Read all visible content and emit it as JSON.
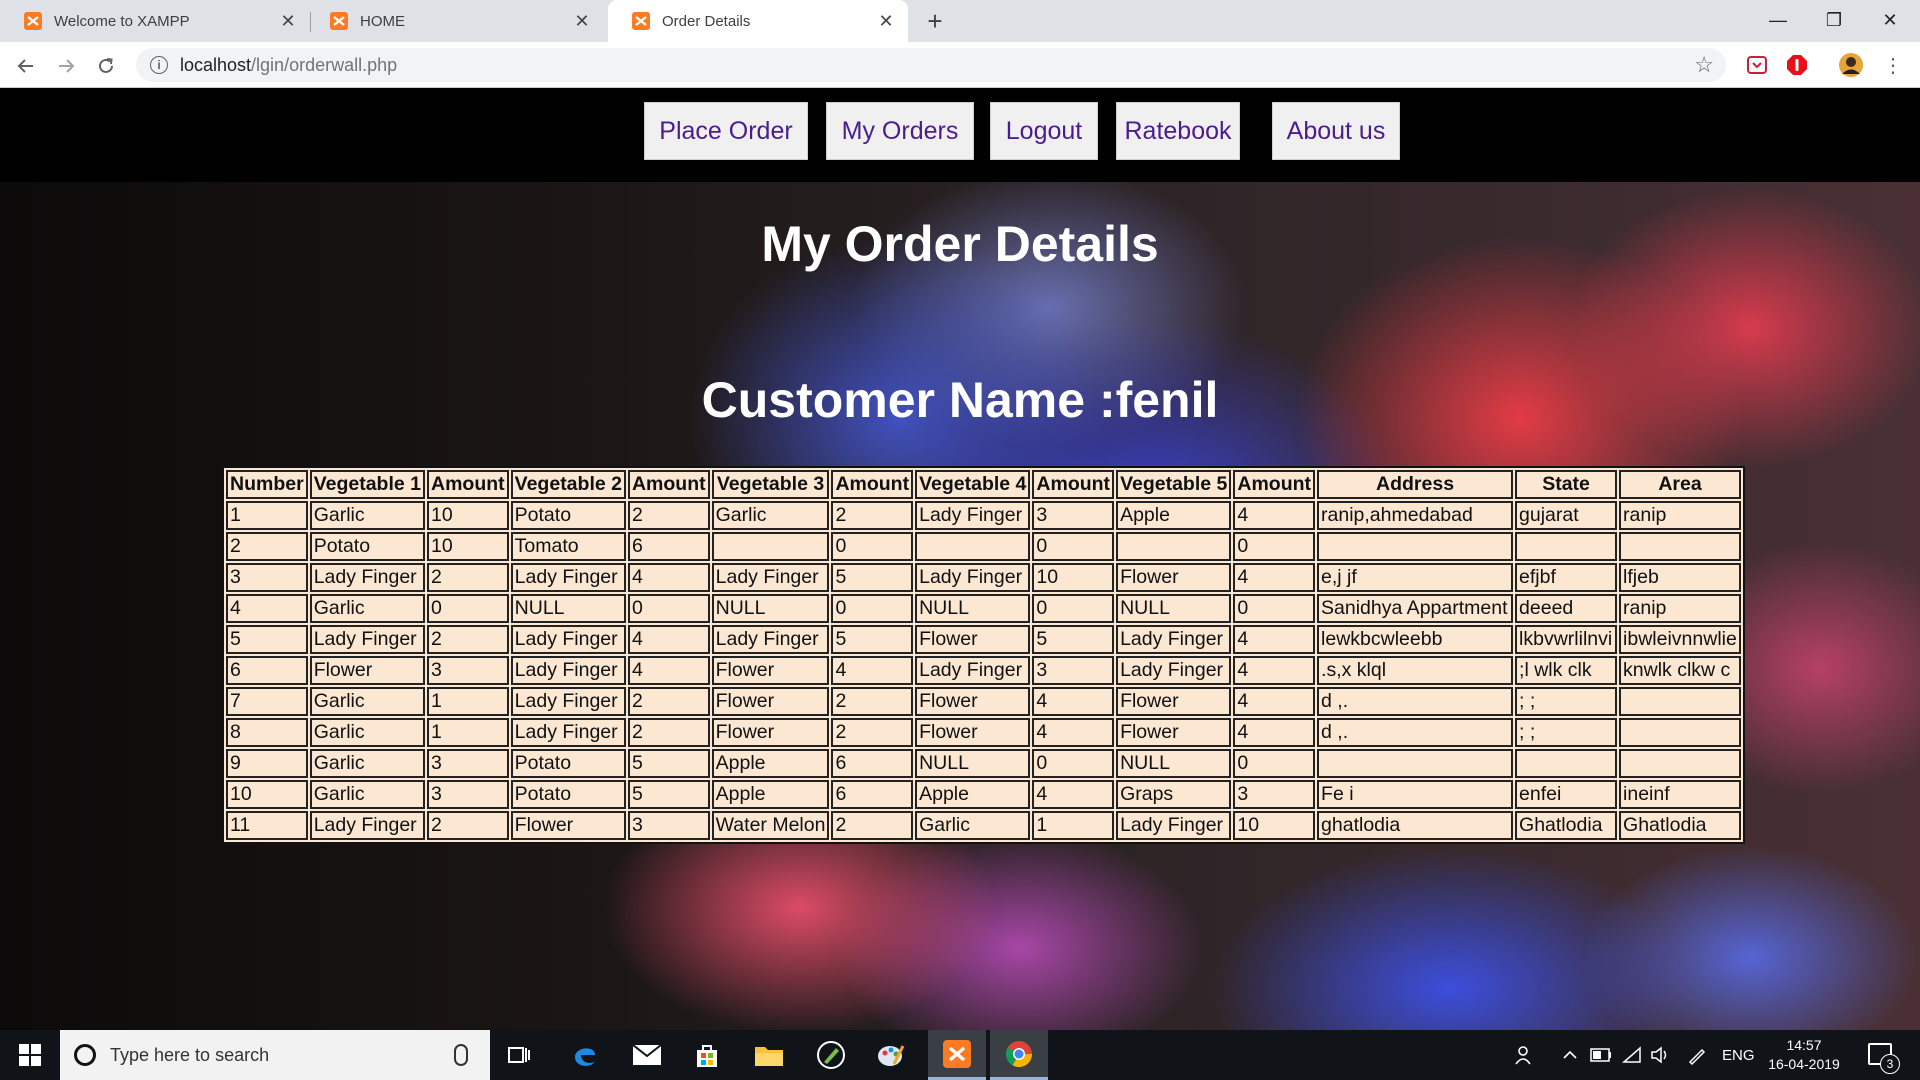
{
  "browser": {
    "tabs": [
      {
        "title": "Welcome to XAMPP",
        "active": false
      },
      {
        "title": "HOME",
        "active": false
      },
      {
        "title": "Order Details",
        "active": true
      }
    ],
    "new_tab": "+",
    "url_host": "localhost",
    "url_path": "/lgin/orderwall.php",
    "window_controls": {
      "minimize": "—",
      "restore": "❐",
      "close": "✕"
    }
  },
  "nav": {
    "place_order": "Place Order",
    "my_orders": "My Orders",
    "logout": "Logout",
    "ratebook": "Ratebook",
    "about_us": "About us"
  },
  "page": {
    "title": "My Order Details",
    "customer_heading": "Customer Name :fenil"
  },
  "table": {
    "headers": [
      "Number",
      "Vegetable 1",
      "Amount",
      "Vegetable 2",
      "Amount",
      "Vegetable 3",
      "Amount",
      "Vegetable 4",
      "Amount",
      "Vegetable 5",
      "Amount",
      "Address",
      "State",
      "Area"
    ],
    "rows": [
      [
        "1",
        "Garlic",
        "10",
        "Potato",
        "2",
        "Garlic",
        "2",
        "Lady Finger",
        "3",
        "Apple",
        "4",
        "ranip,ahmedabad",
        "gujarat",
        "ranip"
      ],
      [
        "2",
        "Potato",
        "10",
        "Tomato",
        "6",
        "",
        "0",
        "",
        "0",
        "",
        "0",
        "",
        "",
        ""
      ],
      [
        "3",
        "Lady Finger",
        "2",
        "Lady Finger",
        "4",
        "Lady Finger",
        "5",
        "Lady Finger",
        "10",
        "Flower",
        "4",
        "e,j jf",
        "efjbf",
        "lfjeb"
      ],
      [
        "4",
        "Garlic",
        "0",
        "NULL",
        "0",
        "NULL",
        "0",
        "NULL",
        "0",
        "NULL",
        "0",
        "Sanidhya Appartment",
        "deeed",
        "ranip"
      ],
      [
        "5",
        "Lady Finger",
        "2",
        "Lady Finger",
        "4",
        "Lady Finger",
        "5",
        "Flower",
        "5",
        "Lady Finger",
        "4",
        "lewkbcwleebb",
        "lkbvwrlilnvi",
        "ibwleivnnwlie"
      ],
      [
        "6",
        "Flower",
        "3",
        "Lady Finger",
        "4",
        "Flower",
        "4",
        "Lady Finger",
        "3",
        "Lady Finger",
        "4",
        ".s,x klql",
        ";l wlk clk",
        "knwlk clkw c"
      ],
      [
        "7",
        "Garlic",
        "1",
        "Lady Finger",
        "2",
        "Flower",
        "2",
        "Flower",
        "4",
        "Flower",
        "4",
        "d ,.",
        "; ;",
        ""
      ],
      [
        "8",
        "Garlic",
        "1",
        "Lady Finger",
        "2",
        "Flower",
        "2",
        "Flower",
        "4",
        "Flower",
        "4",
        "d ,.",
        "; ;",
        ""
      ],
      [
        "9",
        "Garlic",
        "3",
        "Potato",
        "5",
        "Apple",
        "6",
        "NULL",
        "0",
        "NULL",
        "0",
        "",
        "",
        ""
      ],
      [
        "10",
        "Garlic",
        "3",
        "Potato",
        "5",
        "Apple",
        "6",
        "Apple",
        "4",
        "Graps",
        "3",
        "Fe i",
        "enfei",
        "ineinf"
      ],
      [
        "11",
        "Lady Finger",
        "2",
        "Flower",
        "3",
        "Water Melon",
        "2",
        "Garlic",
        "1",
        "Lady Finger",
        "10",
        "ghatlodia",
        "Ghatlodia",
        "Ghatlodia"
      ]
    ]
  },
  "taskbar": {
    "search_placeholder": "Type here to search",
    "language": "ENG",
    "time": "14:57",
    "date": "16-04-2019",
    "notification_count": "3"
  },
  "colors": {
    "nav_text": "#4b1c8f",
    "table_bg": "#fbe7d2",
    "xampp_orange": "#fb7a24"
  }
}
